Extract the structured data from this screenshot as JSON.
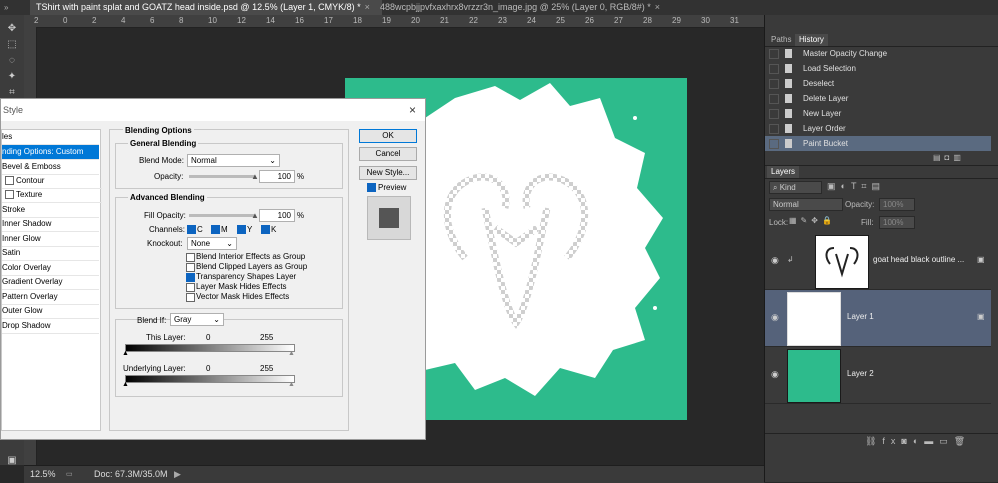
{
  "tabs": [
    {
      "label": "TShirt with paint splat and GOATZ  head inside.psd @ 12.5% (Layer 1, CMYK/8) *",
      "close": "×"
    },
    {
      "label": "488wcpbjjpvfxaxhrx8vrzzr3n_image.jpg @ 25% (Layer 0, RGB/8#) *",
      "close": "×"
    }
  ],
  "ruler_top": [
    "2",
    "0",
    "2",
    "4",
    "6",
    "8",
    "10",
    "12",
    "14",
    "16",
    "17",
    "18",
    "19",
    "20",
    "21",
    "22",
    "23",
    "24",
    "25",
    "26",
    "27",
    "28",
    "29",
    "30",
    "31"
  ],
  "status": {
    "zoom": "12.5%",
    "doc": "Doc: 67.3M/35.0M",
    "arrow": "▶"
  },
  "history": {
    "tabs": [
      "Paths",
      "History"
    ],
    "items": [
      "Master Opacity Change",
      "Load Selection",
      "Deselect",
      "Delete Layer",
      "New Layer",
      "Layer Order",
      "Paint Bucket"
    ]
  },
  "layers": {
    "tab": "Layers",
    "kind": "Kind",
    "blend": "Normal",
    "opacity_label": "Opacity:",
    "opacity": "100%",
    "lock_label": "Lock:",
    "fill_label": "Fill:",
    "fill": "100%",
    "items": [
      {
        "name": "goat head black outline ..."
      },
      {
        "name": "Layer 1"
      },
      {
        "name": "Layer 2"
      }
    ],
    "footer_icons": [
      "link-icon",
      "fx-icon",
      "mask-icon",
      "adjustment-icon",
      "folder-icon",
      "new-layer-icon",
      "trash-icon"
    ]
  },
  "dialog": {
    "title": "Style",
    "close": "×",
    "styles_header": "les",
    "style_list": [
      "nding Options: Custom",
      "Bevel & Emboss",
      "Contour",
      "Texture",
      "Stroke",
      "Inner Shadow",
      "Inner Glow",
      "Satin",
      "Color Overlay",
      "Gradient Overlay",
      "Pattern Overlay",
      "Outer Glow",
      "Drop Shadow"
    ],
    "section": "Blending Options",
    "general": "General Blending",
    "blend_mode_label": "Blend Mode:",
    "blend_mode": "Normal",
    "opacity_label": "Opacity:",
    "opacity": "100",
    "pct": "%",
    "advanced": "Advanced Blending",
    "fill_label": "Fill Opacity:",
    "fill": "100",
    "channels_label": "Channels:",
    "channels": [
      "C",
      "M",
      "Y",
      "K"
    ],
    "knockout_label": "Knockout:",
    "knockout": "None",
    "options": [
      {
        "label": "Blend Interior Effects as Group",
        "checked": false
      },
      {
        "label": "Blend Clipped Layers as Group",
        "checked": false
      },
      {
        "label": "Transparency Shapes Layer",
        "checked": true
      },
      {
        "label": "Layer Mask Hides Effects",
        "checked": false
      },
      {
        "label": "Vector Mask Hides Effects",
        "checked": false
      }
    ],
    "blendif_label": "Blend If:",
    "blendif": "Gray",
    "this_layer": "This Layer:",
    "underlying": "Underlying Layer:",
    "low": "0",
    "high": "255",
    "buttons": {
      "ok": "OK",
      "cancel": "Cancel",
      "new_style": "New Style...",
      "preview": "Preview"
    }
  }
}
